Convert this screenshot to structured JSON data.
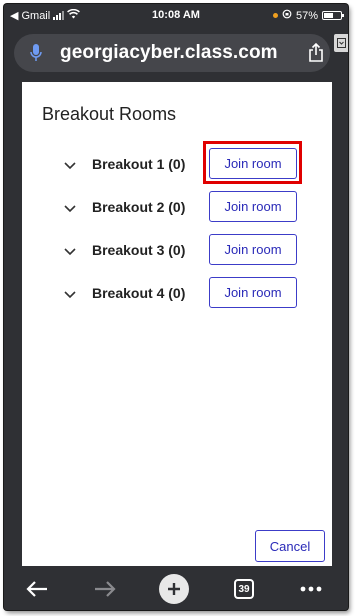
{
  "status_bar": {
    "back_app": "Gmail",
    "time": "10:08 AM",
    "battery_percent": "57%",
    "battery_level": 0.57
  },
  "browser": {
    "url": "georgiacyber.class.com",
    "tab_count": "39"
  },
  "dialog": {
    "title": "Breakout Rooms",
    "rooms": [
      {
        "name": "Breakout 1 (0)",
        "join_label": "Join room"
      },
      {
        "name": "Breakout 2 (0)",
        "join_label": "Join room"
      },
      {
        "name": "Breakout 3 (0)",
        "join_label": "Join room"
      },
      {
        "name": "Breakout 4 (0)",
        "join_label": "Join room"
      }
    ],
    "cancel_label": "Cancel"
  },
  "colors": {
    "button_border": "#3c3cc8",
    "highlight": "#e00000",
    "chrome": "#2f3034"
  }
}
